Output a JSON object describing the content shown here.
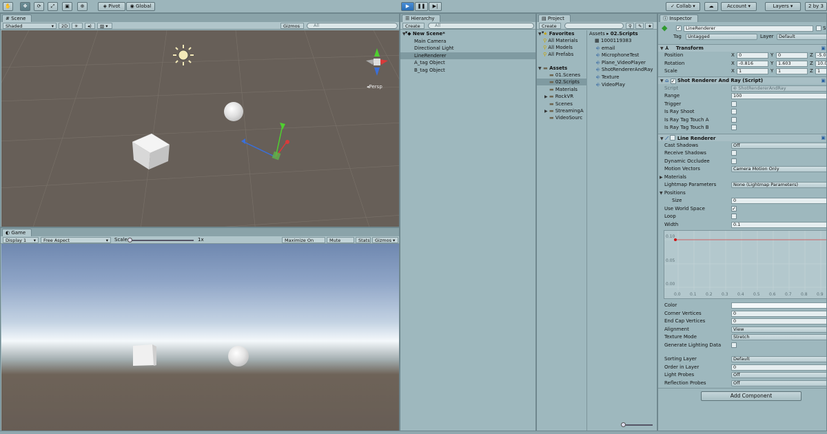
{
  "toolbar": {
    "pivot": "Pivot",
    "global": "Global",
    "collab": "Collab",
    "account": "Account",
    "layers": "Layers",
    "layout": "2 by 3"
  },
  "scene": {
    "tab": "Scene",
    "shading": "Shaded",
    "mode2d": "2D",
    "gizmos": "Gizmos",
    "search_placeholder": "All",
    "persp": "Persp"
  },
  "game": {
    "tab": "Game",
    "display": "Display 1",
    "aspect": "Free Aspect",
    "scale_label": "Scale",
    "scale_value": "1x",
    "maximize": "Maximize On Play",
    "mute": "Mute Audio",
    "stats": "Stats",
    "gizmos": "Gizmos"
  },
  "hierarchy": {
    "tab": "Hierarchy",
    "create": "Create",
    "search_placeholder": "All",
    "scene_name": "New Scene*",
    "items": [
      {
        "label": "Main Camera",
        "selected": false
      },
      {
        "label": "Directional Light",
        "selected": false
      },
      {
        "label": "LineRenderer",
        "selected": true
      },
      {
        "label": "A_tag Object",
        "selected": false
      },
      {
        "label": "B_tag Object",
        "selected": false
      }
    ]
  },
  "project": {
    "tab": "Project",
    "create": "Create",
    "favorites": "Favorites",
    "favorite_items": [
      "All Materials",
      "All Models",
      "All Prefabs"
    ],
    "assets": "Assets",
    "asset_folders": [
      {
        "label": "01.Scenes",
        "selected": false
      },
      {
        "label": "02.Scripts",
        "selected": true
      },
      {
        "label": "Materials",
        "selected": false
      },
      {
        "label": "RockVR",
        "selected": false
      },
      {
        "label": "Scenes",
        "selected": false
      },
      {
        "label": "StreamingA",
        "selected": false
      },
      {
        "label": "VideoSourc",
        "selected": false
      }
    ],
    "breadcrumb_root": "Assets",
    "breadcrumb_current": "02.Scripts",
    "files": [
      "1000119383",
      "email",
      "MicrophoneTest",
      "Plane_VideoPlayer",
      "ShotRendererAndRay",
      "Texture",
      "VideoPlay"
    ]
  },
  "inspector": {
    "tab": "Inspector",
    "object_name": "LineRenderer",
    "static_label": "St",
    "tag_label": "Tag",
    "tag_value": "Untagged",
    "layer_label": "Layer",
    "layer_value": "Default",
    "transform": {
      "title": "Transform",
      "position_label": "Position",
      "rotation_label": "Rotation",
      "scale_label": "Scale",
      "position": [
        "0",
        "0",
        "-5.05"
      ],
      "rotation": [
        "-0.816",
        "1.603",
        "10.02"
      ],
      "scale": [
        "1",
        "1",
        "1"
      ]
    },
    "script": {
      "title": "Shot Renderer And Ray (Script)",
      "script_label": "Script",
      "script_value": "ShotRendererAndRay",
      "range_label": "Range",
      "range_value": "100",
      "trigger_label": "Trigger",
      "is_ray_shoot": "Is Ray Shoot",
      "is_ray_tag_a": "Is Ray Tag Touch A",
      "is_ray_tag_b": "Is Ray Tag Touch B"
    },
    "line_renderer": {
      "title": "Line Renderer",
      "cast_shadows_label": "Cast Shadows",
      "cast_shadows_value": "Off",
      "receive_shadows": "Receive Shadows",
      "dynamic_occludee": "Dynamic Occludee",
      "motion_vectors_label": "Motion Vectors",
      "motion_vectors_value": "Camera Motion Only",
      "materials": "Materials",
      "lightmap_label": "Lightmap Parameters",
      "lightmap_value": "None (Lightmap Parameters)",
      "positions": "Positions",
      "size_label": "Size",
      "size_value": "0",
      "use_world_space": "Use World Space",
      "loop": "Loop",
      "width_label": "Width",
      "width_value": "0.1",
      "curve_y_top": "0.10",
      "curve_y_mid": "0.05",
      "curve_y_bottom": "0.00",
      "curve_x_ticks": [
        "0.0",
        "0.1",
        "0.2",
        "0.3",
        "0.4",
        "0.5",
        "0.6",
        "0.7",
        "0.8",
        "0.9"
      ],
      "color_label": "Color",
      "corner_vertices_label": "Corner Vertices",
      "corner_vertices_value": "0",
      "end_cap_label": "End Cap Vertices",
      "end_cap_value": "0",
      "alignment_label": "Alignment",
      "alignment_value": "View",
      "texture_mode_label": "Texture Mode",
      "texture_mode_value": "Stretch",
      "gen_lighting_label": "Generate Lighting Data",
      "sorting_layer_label": "Sorting Layer",
      "sorting_layer_value": "Default",
      "order_label": "Order in Layer",
      "order_value": "0",
      "light_probes_label": "Light Probes",
      "light_probes_value": "Off",
      "reflection_probes_label": "Reflection Probes",
      "reflection_probes_value": "Off"
    },
    "add_component": "Add Component"
  },
  "colors": {
    "panel": "#9eb8be",
    "selection": "#7f9aa1",
    "play_accent": "#2a6fb7",
    "scene_bg": "#675f58"
  }
}
